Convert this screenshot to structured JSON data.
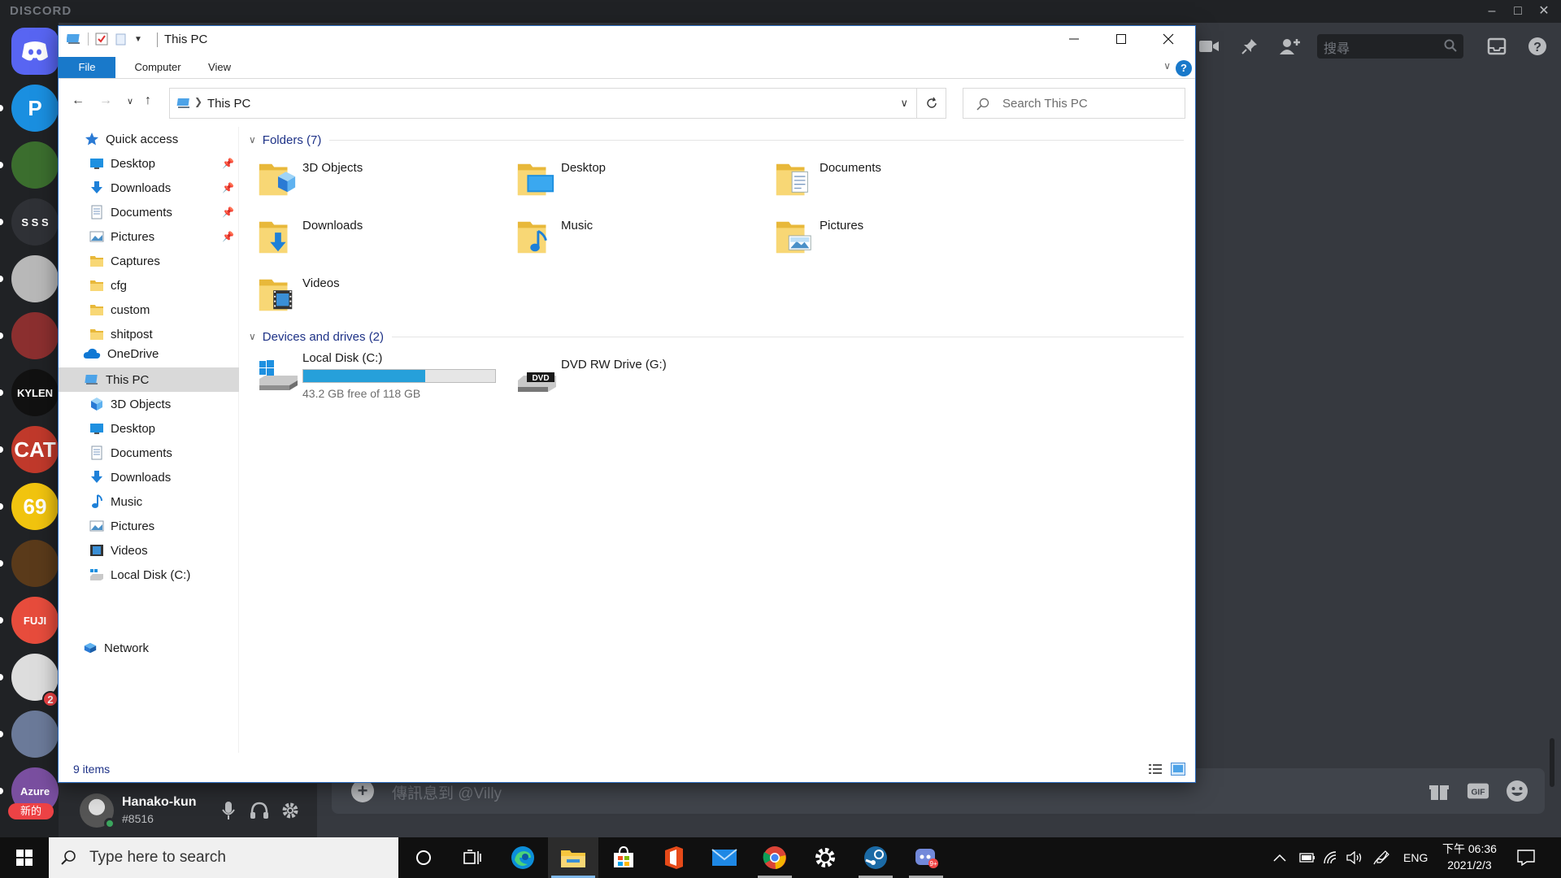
{
  "discord": {
    "logo": "DISCORD",
    "search_placeholder": "搜尋",
    "message_placeholder": "傳訊息到 @Villy",
    "user": {
      "name": "Hanako-kun",
      "tag": "#8516"
    },
    "servers": [
      {
        "label": "",
        "color": "#5865f2"
      },
      {
        "label": "P",
        "color": "#1a8fe0"
      },
      {
        "label": "",
        "color": "#3b6e2e"
      },
      {
        "label": "S S S",
        "color": "#2f3136"
      },
      {
        "label": "",
        "color": "#b8b8b8"
      },
      {
        "label": "",
        "color": "#8b2f2f"
      },
      {
        "label": "KYLEN",
        "color": "#111111"
      },
      {
        "label": "CAT",
        "color": "#c0392b"
      },
      {
        "label": "69",
        "color": "#f1c40f"
      },
      {
        "label": "",
        "color": "#5a3a1a"
      },
      {
        "label": "FUJI",
        "color": "#e74c3c"
      },
      {
        "label": "",
        "color": "#dddddd"
      },
      {
        "label": "",
        "color": "#6b7a99"
      },
      {
        "label": "Azure",
        "color": "#7a4fa0"
      }
    ],
    "unread_badge": "2",
    "new_badge": "新的"
  },
  "explorer": {
    "title": "This PC",
    "tabs": [
      "File",
      "Computer",
      "View"
    ],
    "address": "This PC",
    "search_placeholder": "Search This PC",
    "nav": {
      "quick_access": "Quick access",
      "quick_items": [
        {
          "label": "Desktop",
          "icon": "desktop-icon",
          "pinned": true
        },
        {
          "label": "Downloads",
          "icon": "downloads-icon",
          "pinned": true
        },
        {
          "label": "Documents",
          "icon": "documents-icon",
          "pinned": true
        },
        {
          "label": "Pictures",
          "icon": "pictures-icon",
          "pinned": true
        },
        {
          "label": "Captures",
          "icon": "folder-icon",
          "pinned": false
        },
        {
          "label": "cfg",
          "icon": "folder-icon",
          "pinned": false
        },
        {
          "label": "custom",
          "icon": "folder-icon",
          "pinned": false
        },
        {
          "label": "shitpost",
          "icon": "folder-icon",
          "pinned": false
        }
      ],
      "onedrive": "OneDrive",
      "this_pc": "This PC",
      "pc_items": [
        {
          "label": "3D Objects",
          "icon": "3d-objects-icon"
        },
        {
          "label": "Desktop",
          "icon": "desktop-icon"
        },
        {
          "label": "Documents",
          "icon": "documents-icon"
        },
        {
          "label": "Downloads",
          "icon": "downloads-icon"
        },
        {
          "label": "Music",
          "icon": "music-icon"
        },
        {
          "label": "Pictures",
          "icon": "pictures-icon"
        },
        {
          "label": "Videos",
          "icon": "videos-icon"
        },
        {
          "label": "Local Disk (C:)",
          "icon": "local-disk-icon"
        }
      ],
      "network": "Network"
    },
    "folders_header": "Folders (7)",
    "folders": [
      {
        "label": "3D Objects",
        "icon": "3d-objects-icon"
      },
      {
        "label": "Desktop",
        "icon": "desktop-icon"
      },
      {
        "label": "Documents",
        "icon": "documents-icon"
      },
      {
        "label": "Downloads",
        "icon": "downloads-icon"
      },
      {
        "label": "Music",
        "icon": "music-icon"
      },
      {
        "label": "Pictures",
        "icon": "pictures-icon"
      },
      {
        "label": "Videos",
        "icon": "videos-icon"
      }
    ],
    "devices_header": "Devices and drives (2)",
    "drives": [
      {
        "label": "Local Disk (C:)",
        "free": "43.2 GB free of 118 GB",
        "used_fraction": 0.634
      },
      {
        "label": "DVD RW Drive (G:)"
      }
    ],
    "dvd_text": "DVD",
    "status": "9 items"
  },
  "taskbar": {
    "search_placeholder": "Type here to search",
    "lang": "ENG",
    "time": "下午 06:36",
    "date": "2021/2/3",
    "apps": [
      "cortana-icon",
      "task-view-icon",
      "edge-icon",
      "file-explorer-icon",
      "store-icon",
      "office-icon",
      "mail-icon",
      "chrome-icon",
      "settings-icon",
      "steam-icon",
      "discord-icon"
    ]
  },
  "colors": {
    "accent": "#1979ca",
    "folder_yellow": "#f8d775",
    "drive_fill": "#26a0da"
  }
}
